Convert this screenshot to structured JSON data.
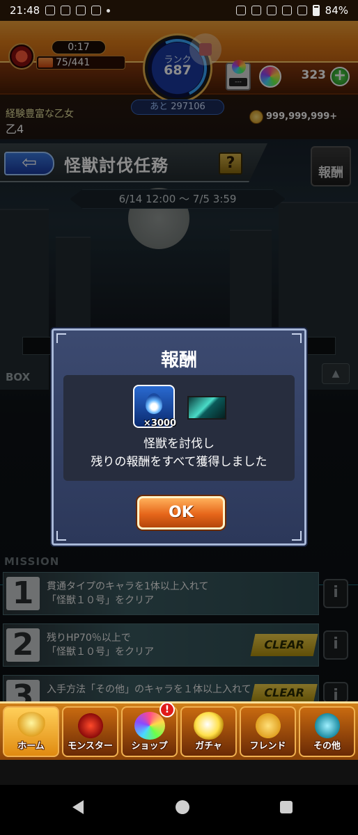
{
  "status_bar": {
    "time": "21:48",
    "battery": "84%"
  },
  "header": {
    "stamina_timer": "0:17",
    "stamina_value": "75/441",
    "stamina_fraction": 0.17,
    "rank_label": "ランク",
    "rank_value": "687",
    "rank_next_prefix": "あと",
    "rank_next_value": "297106",
    "box_icon_text": "---",
    "orb_count": "323",
    "add_label": "+",
    "player_title": "経験豊富な乙女",
    "player_name": "乙4",
    "coin_count": "999,999,999+"
  },
  "page": {
    "back_label": "⇦",
    "title": "怪獣討伐任務",
    "help_label": "?",
    "reward_button_label": "報酬",
    "period": "6/14 12:00 〜 7/5 3:59",
    "box_label": "BOX",
    "box_arrow": "▲",
    "mission_header": "MISSION",
    "missions": [
      {
        "num": "1",
        "line1": "貫通タイプのキャラを1体以上入れて",
        "line2": "「怪獣１０号」をクリア",
        "clear": ""
      },
      {
        "num": "2",
        "line1": "残りHP70％以上で",
        "line2": "「怪獣１０号」をクリア",
        "clear": "CLEAR"
      },
      {
        "num": "3",
        "line1": "入手方法「その他」のキャラを１体以上入れて",
        "line2": "",
        "clear": "CLEAR"
      }
    ],
    "mission_info_label": "i"
  },
  "modal": {
    "title": "報酬",
    "reward_qty": "×3000",
    "message_line1": "怪獣を討伐し",
    "message_line2": "残りの報酬をすべて獲得しました",
    "ok_label": "OK"
  },
  "bottom_nav": [
    {
      "label": "ホーム",
      "icon": "home-icon"
    },
    {
      "label": "モンスター",
      "icon": "monster-icon"
    },
    {
      "label": "ショップ",
      "icon": "shop-icon",
      "badge": "!"
    },
    {
      "label": "ガチャ",
      "icon": "gacha-icon"
    },
    {
      "label": "フレンド",
      "icon": "friend-icon"
    },
    {
      "label": "その他",
      "icon": "other-icon"
    }
  ]
}
